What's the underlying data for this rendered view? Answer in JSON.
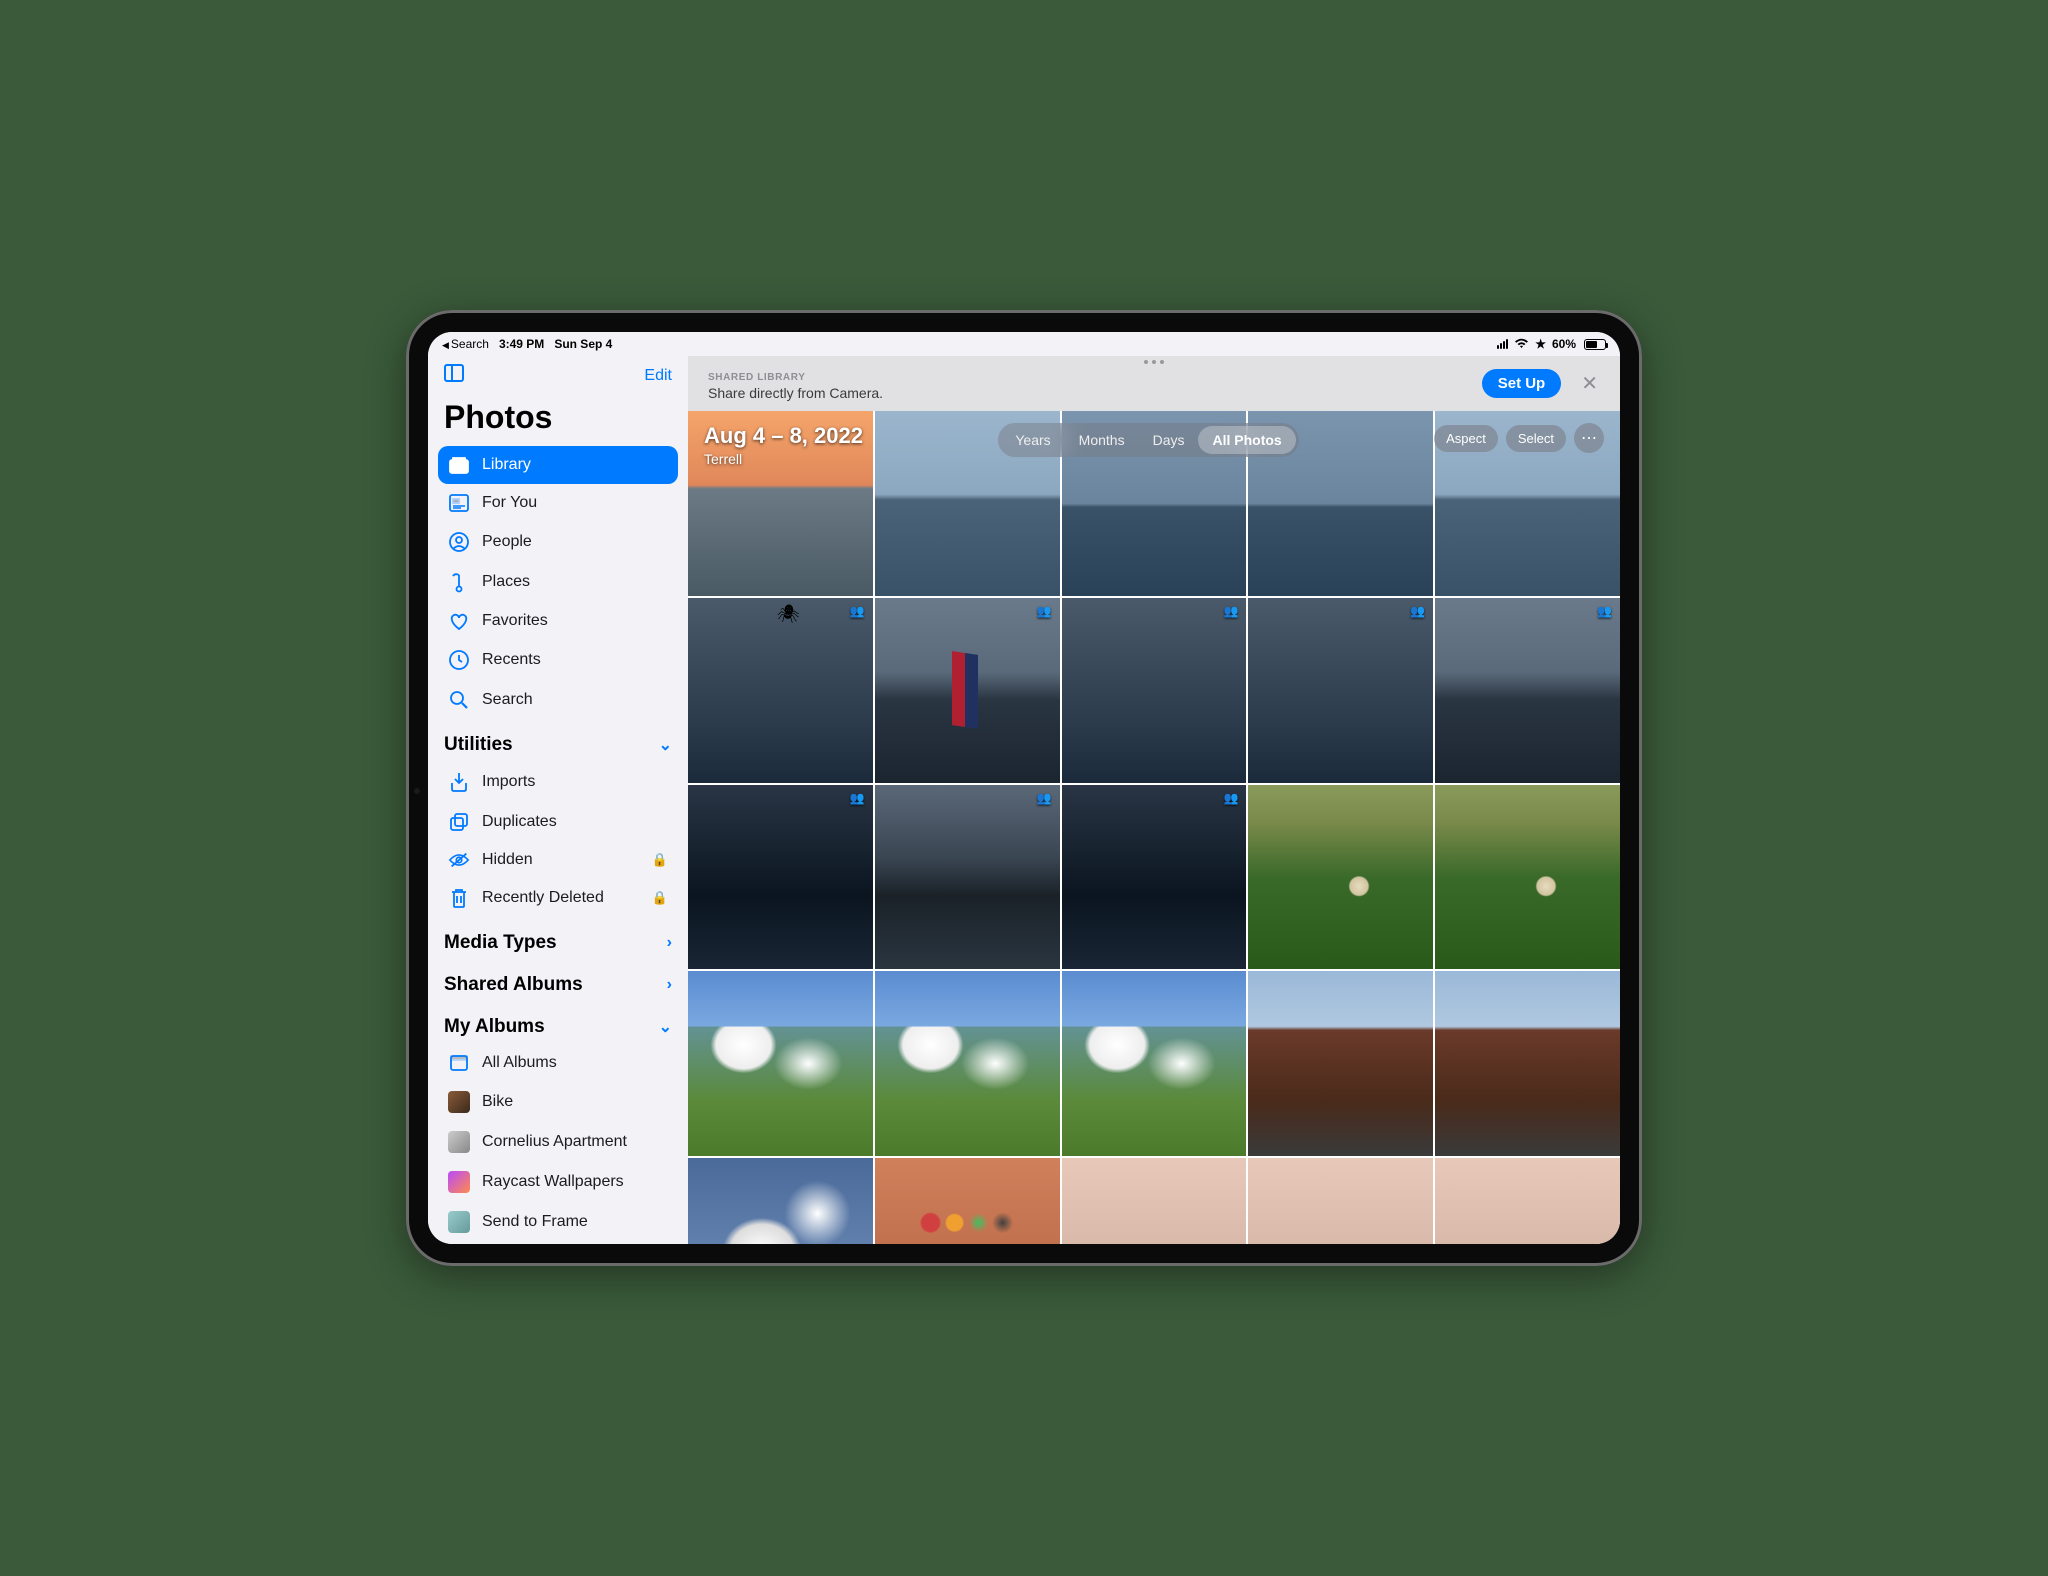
{
  "status": {
    "back": "Search",
    "time": "3:49 PM",
    "date": "Sun Sep 4",
    "battery_pct": "60%"
  },
  "sidebar": {
    "edit": "Edit",
    "title": "Photos",
    "nav": [
      {
        "label": "Library",
        "icon": "library",
        "active": true
      },
      {
        "label": "For You",
        "icon": "foryou"
      },
      {
        "label": "People",
        "icon": "people"
      },
      {
        "label": "Places",
        "icon": "places"
      },
      {
        "label": "Favorites",
        "icon": "heart"
      },
      {
        "label": "Recents",
        "icon": "clock"
      },
      {
        "label": "Search",
        "icon": "search"
      }
    ],
    "sections": {
      "utilities": {
        "label": "Utilities",
        "items": [
          {
            "label": "Imports",
            "icon": "import"
          },
          {
            "label": "Duplicates",
            "icon": "duplicates"
          },
          {
            "label": "Hidden",
            "icon": "hidden",
            "locked": true
          },
          {
            "label": "Recently Deleted",
            "icon": "trash",
            "locked": true
          }
        ]
      },
      "media_types": {
        "label": "Media Types"
      },
      "shared_albums": {
        "label": "Shared Albums"
      },
      "my_albums": {
        "label": "My Albums",
        "items": [
          {
            "label": "All Albums",
            "icon": "album"
          },
          {
            "label": "Bike",
            "thumb": "brown"
          },
          {
            "label": "Cornelius Apartment",
            "thumb": "gray"
          },
          {
            "label": "Raycast Wallpapers",
            "thumb": "grad"
          },
          {
            "label": "Send to Frame",
            "thumb": "cloud"
          }
        ]
      }
    }
  },
  "banner": {
    "label": "SHARED LIBRARY",
    "sub": "Share directly from Camera.",
    "setup": "Set Up"
  },
  "header": {
    "date_range": "Aug 4 – 8, 2022",
    "location": "Terrell",
    "segments": [
      "Years",
      "Months",
      "Days",
      "All Photos"
    ],
    "active_segment": 3,
    "tools": {
      "aspect": "Aspect",
      "select": "Select",
      "more": "⋯"
    }
  },
  "grid": [
    {
      "style": "sunset"
    },
    {
      "style": "lake1"
    },
    {
      "style": "lake2"
    },
    {
      "style": "lake2"
    },
    {
      "style": "lake1"
    },
    {
      "style": "storm spider",
      "shared": true
    },
    {
      "style": "dusk flag",
      "shared": true
    },
    {
      "style": "storm",
      "shared": true
    },
    {
      "style": "storm",
      "shared": true
    },
    {
      "style": "dusk",
      "shared": true
    },
    {
      "style": "night",
      "shared": true
    },
    {
      "style": "dusk2",
      "shared": true
    },
    {
      "style": "night",
      "shared": true
    },
    {
      "style": "grass"
    },
    {
      "style": "grass"
    },
    {
      "style": "sky"
    },
    {
      "style": "sky"
    },
    {
      "style": "sky"
    },
    {
      "style": "bridge"
    },
    {
      "style": "bridge"
    },
    {
      "style": "clouds"
    },
    {
      "style": "home"
    },
    {
      "style": "pink"
    },
    {
      "style": "pink"
    },
    {
      "style": "pink"
    }
  ]
}
